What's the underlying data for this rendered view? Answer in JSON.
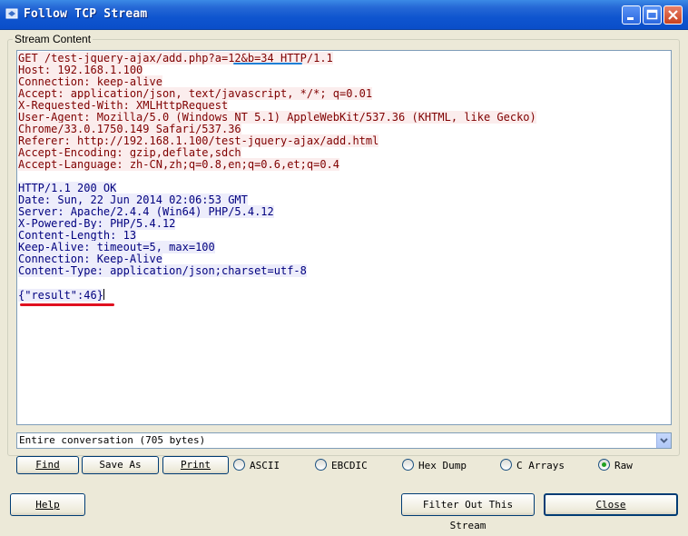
{
  "window": {
    "title": "Follow TCP Stream",
    "controls": {
      "minimize_icon": "minimize-icon",
      "maximize_icon": "maximize-icon",
      "close_icon": "close-icon"
    }
  },
  "stream": {
    "group_label": "Stream Content",
    "client_lines": [
      "GET /test-jquery-ajax/add.php?a=12&b=34 HTTP/1.1",
      "Host: 192.168.1.100",
      "Connection: keep-alive",
      "Accept: application/json, text/javascript, */*; q=0.01",
      "X-Requested-With: XMLHttpRequest",
      "User-Agent: Mozilla/5.0 (Windows NT 5.1) AppleWebKit/537.36 (KHTML, like Gecko)",
      "Chrome/33.0.1750.149 Safari/537.36",
      "Referer: http://192.168.1.100/test-jquery-ajax/add.html",
      "Accept-Encoding: gzip,deflate,sdch",
      "Accept-Language: zh-CN,zh;q=0.8,en;q=0.6,et;q=0.4"
    ],
    "server_lines": [
      "HTTP/1.1 200 OK",
      "Date: Sun, 22 Jun 2014 02:06:53 GMT",
      "Server: Apache/2.4.4 (Win64) PHP/5.4.12",
      "X-Powered-By: PHP/5.4.12",
      "Content-Length: 13",
      "Keep-Alive: timeout=5, max=100",
      "Connection: Keep-Alive",
      "Content-Type: application/json;charset=utf-8"
    ],
    "server_body": "{\"result\":46}",
    "colors": {
      "client_bg": "#fbeded",
      "client_fg": "#7f0000",
      "server_bg": "#ededfb",
      "server_fg": "#00007f"
    }
  },
  "conversation_select": {
    "value": "Entire conversation (705 bytes)"
  },
  "toolbar": {
    "find_label": "Find",
    "save_as_label": "Save As",
    "print_label": "Print"
  },
  "formats": {
    "selected": "Raw",
    "options": [
      "ASCII",
      "EBCDIC",
      "Hex Dump",
      "C Arrays",
      "Raw"
    ]
  },
  "footer": {
    "help_label": "Help",
    "filter_label": "Filter Out This Stream",
    "close_label": "Close"
  }
}
